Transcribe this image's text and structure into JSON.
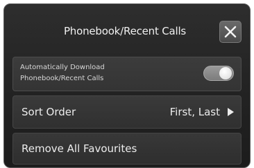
{
  "header": {
    "title": "Phonebook/Recent Calls",
    "close_icon": "close-icon"
  },
  "settings": {
    "auto_download": {
      "label_line1": "Automatically Download",
      "label_line2": "Phonebook/Recent Calls",
      "enabled": true
    },
    "sort_order": {
      "label": "Sort Order",
      "value": "First, Last",
      "arrow_icon": "triangle-right-icon"
    },
    "remove_favourites": {
      "label": "Remove All Favourites"
    }
  }
}
